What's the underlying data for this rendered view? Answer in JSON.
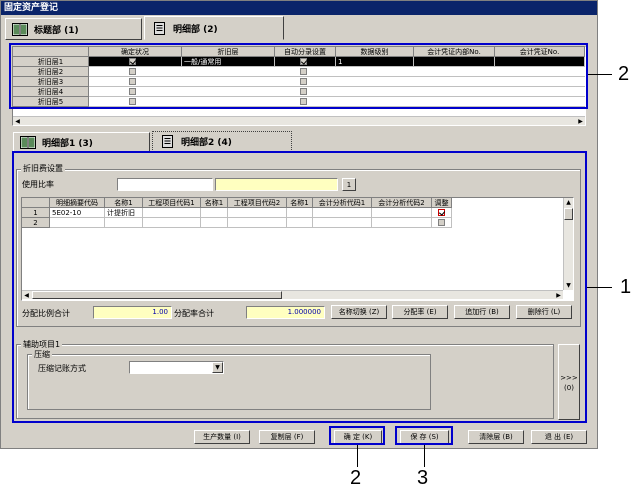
{
  "window": {
    "title": "固定资产登记"
  },
  "top_tabs": [
    {
      "label": "标题部 (1)"
    },
    {
      "label": "明细部 (2)"
    }
  ],
  "depreciation_grid": {
    "columns": [
      "确定状况",
      "折旧层",
      "自动分录设置",
      "数据级别",
      "会计凭证内部No.",
      "会计凭证No."
    ],
    "rows": [
      {
        "label": "折旧层1",
        "type": "一般/通常用",
        "level": "1"
      },
      {
        "label": "折旧层2",
        "type": "",
        "level": ""
      },
      {
        "label": "折旧层3",
        "type": "",
        "level": ""
      },
      {
        "label": "折旧层4",
        "type": "",
        "level": ""
      },
      {
        "label": "折旧层5",
        "type": "",
        "level": ""
      }
    ]
  },
  "sub_tabs": [
    {
      "label": "明细部1 (3)"
    },
    {
      "label": "明细部2 (4)"
    }
  ],
  "expense_settings": {
    "group_title": "折旧费设置",
    "usage_ratio_label": "使用比率",
    "usage_ratio_value": "",
    "usage_ratio_name": "",
    "lookup_button": "1",
    "grid": {
      "columns": [
        "明细摘要代码",
        "名称1",
        "工程项目代码1",
        "名称1",
        "工程项目代码2",
        "名称1",
        "会计分析代码1",
        "会计分析代码2",
        "调整"
      ],
      "rows": [
        {
          "no": "1",
          "code": "5E02-10",
          "name": "计提折旧",
          "adjust": true
        },
        {
          "no": "2",
          "code": "",
          "name": "",
          "adjust": false
        }
      ]
    },
    "alloc_total_label": "分配比例合计",
    "alloc_total_value": "1.00",
    "alloc_rate_label": "分配率合计",
    "alloc_rate_value": "1.000000",
    "buttons": {
      "switch_name": "名称切换 (Z)",
      "alloc_rate": "分配率 (E)",
      "add_row": "追加行 (B)",
      "delete_row": "删除行 (L)"
    }
  },
  "auxiliary": {
    "group_title": "辅助项目1",
    "compress_title": "压缩",
    "method_label": "压缩记账方式",
    "method_value": "",
    "more_button_line1": ">>>",
    "more_button_line2": "(0)"
  },
  "footer_buttons": {
    "production_qty": "生产数量 (I)",
    "copy_layer": "复制层 (F)",
    "confirm": "确  定 (K)",
    "save": "保  存 (S)",
    "clear_layer": "清除层 (B)",
    "exit": "退  出 (E)"
  },
  "callouts": {
    "one": "1",
    "two": "2",
    "two_b": "2",
    "three": "3"
  },
  "colors": {
    "window_bg": "#d4d0c8",
    "titlebar": "#0a246a",
    "selected_row": "#000000",
    "callout": "#0000cc",
    "yellow_input": "#ffffc0"
  }
}
